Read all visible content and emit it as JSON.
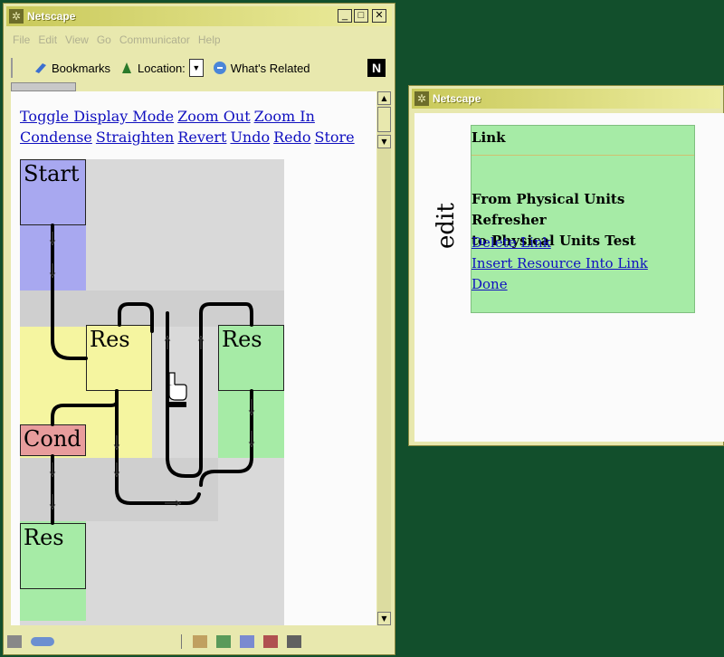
{
  "main_window": {
    "title": "Netscape",
    "menu": [
      "File",
      "Edit",
      "View",
      "Go",
      "Communicator",
      "Help"
    ],
    "toolbar": {
      "bookmarks": "Bookmarks",
      "location": "Location:",
      "whats_related": "What's Related"
    },
    "nav_links": {
      "row1": [
        "Toggle Display Mode",
        "Zoom Out",
        "Zoom In"
      ],
      "row2": [
        "Condense",
        "Straighten",
        "Revert",
        "Undo",
        "Redo",
        "Store"
      ]
    },
    "diagram": {
      "nodes": [
        "Start",
        "Res",
        "Res",
        "Cond",
        "Res"
      ]
    }
  },
  "edit_window": {
    "title": "Netscape",
    "side_label": "edit",
    "panel_title": "Link",
    "description_line1": "From Physical Units Refresher",
    "description_line2": "to Physical Units Test",
    "actions": [
      "Delete Link",
      "Insert Resource Into Link",
      "Done"
    ]
  },
  "colors": {
    "desktop": "#124f2c",
    "window_frame": "#e8e8ae",
    "start_node": "#a8a8f0",
    "res_yellow": "#f5f5a0",
    "res_green": "#a6eba6",
    "cond_node": "#e89c9c",
    "link_panel": "#a6eba6"
  }
}
